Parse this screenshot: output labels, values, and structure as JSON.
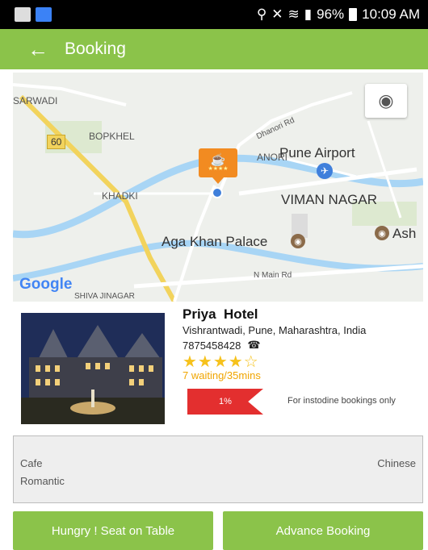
{
  "status_bar": {
    "wifi": "wifi-icon",
    "signal": "signal-icon",
    "battery_percent": "96%",
    "time": "10:09 AM"
  },
  "header": {
    "title": "Booking"
  },
  "map": {
    "labels": {
      "sarwadi": "SARWADI",
      "bopkhel": "BOPKHEL",
      "road_60": "60",
      "dhanori": "ANORI",
      "dhanori_rd": "Dhanori Rd",
      "pune_airport": "Pune Airport",
      "khadki": "KHADKI",
      "viman_nagar": "VIMAN NAGAR",
      "aga_khan": "Aga Khan Palace",
      "ash": "Ash",
      "n_main_rd": "N Main Rd",
      "shiva_jinagar": "SHIVA JINAGAR",
      "google": "Google"
    }
  },
  "hotel": {
    "name": "Priya  Hotel",
    "address": "Vishrantwadi, Pune, Maharashtra, India",
    "phone": "7875458428",
    "rating_stars": "★★★★☆",
    "rating": 4,
    "waiting": "7 waiting/35mins",
    "discount": "1%",
    "discount_note": "For instodine bookings only"
  },
  "tags": {
    "category": "Cafe",
    "cuisine": "Chinese",
    "ambience": "Romantic"
  },
  "actions": {
    "seat_now": "Hungry ! Seat on Table",
    "advance": "Advance Booking"
  },
  "colors": {
    "accent": "#8bc34a",
    "discount": "#e32f2f",
    "star": "#f6c21c"
  }
}
